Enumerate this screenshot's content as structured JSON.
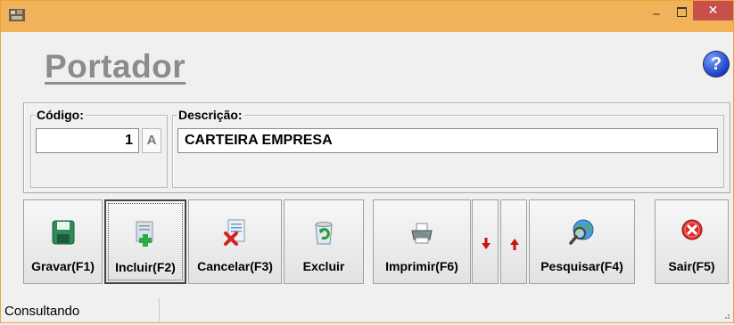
{
  "window": {
    "minimize_glyph": "_",
    "close_glyph": "✕"
  },
  "header": {
    "title": "Portador",
    "help_glyph": "?"
  },
  "form": {
    "codigo": {
      "label": "Código:",
      "value": "1",
      "suffix": "A"
    },
    "descricao": {
      "label": "Descrição:",
      "value": "CARTEIRA EMPRESA"
    }
  },
  "toolbar": {
    "gravar": "Gravar(F1)",
    "incluir": "Incluir(F2)",
    "cancelar": "Cancelar(F3)",
    "excluir": "Excluir",
    "imprimir": "Imprimir(F6)",
    "pesquisar": "Pesquisar(F4)",
    "sair": "Sair(F5)"
  },
  "status": {
    "text": "Consultando"
  },
  "colors": {
    "titlebar": "#f2b25a",
    "close": "#c7504a",
    "title_text": "#8c8c8c",
    "arrow_red": "#cc1111"
  }
}
